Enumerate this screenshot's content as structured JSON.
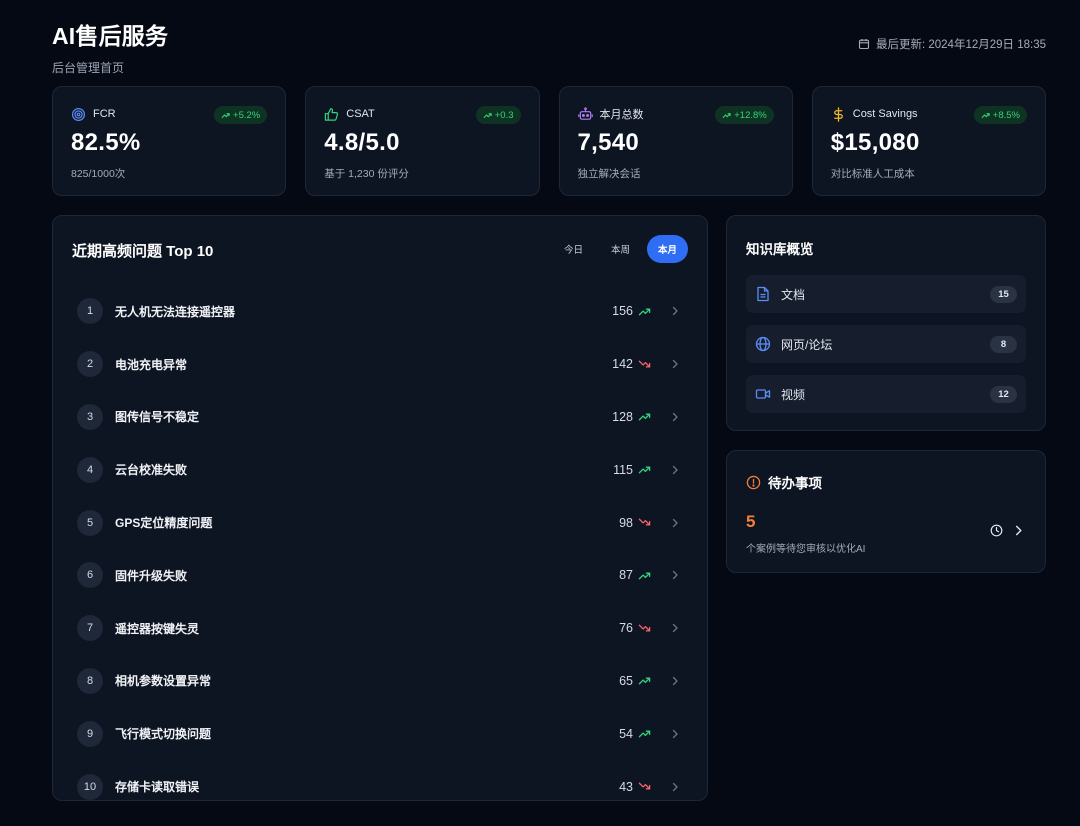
{
  "header": {
    "title": "AI售后服务",
    "subtitle": "后台管理首页",
    "last_update": "最后更新: 2024年12月29日 18:35"
  },
  "kpis": [
    {
      "label": "FCR",
      "icon": "target-icon",
      "value": "82.5%",
      "delta": "+5.2%",
      "sub": "825/1000次"
    },
    {
      "label": "CSAT",
      "icon": "thumbs-up-icon",
      "value": "4.8/5.0",
      "delta": "+0.3",
      "sub": "基于 1,230 份评分"
    },
    {
      "label": "本月总数",
      "icon": "robot-icon",
      "value": "7,540",
      "delta": "+12.8%",
      "sub": "独立解决会话"
    },
    {
      "label": "Cost Savings",
      "icon": "dollar-icon",
      "value": "$15,080",
      "delta": "+8.5%",
      "sub": "对比标准人工成本"
    }
  ],
  "issues_panel": {
    "title": "近期高频问题 Top 10",
    "tabs": [
      {
        "label": "今日",
        "active": false
      },
      {
        "label": "本周",
        "active": false
      },
      {
        "label": "本月",
        "active": true
      }
    ],
    "rows": [
      {
        "rank": "1",
        "name": "无人机无法连接遥控器",
        "count": "156",
        "trend": "up"
      },
      {
        "rank": "2",
        "name": "电池充电异常",
        "count": "142",
        "trend": "down"
      },
      {
        "rank": "3",
        "name": "图传信号不稳定",
        "count": "128",
        "trend": "up"
      },
      {
        "rank": "4",
        "name": "云台校准失败",
        "count": "115",
        "trend": "up"
      },
      {
        "rank": "5",
        "name": "GPS定位精度问题",
        "count": "98",
        "trend": "down"
      },
      {
        "rank": "6",
        "name": "固件升级失败",
        "count": "87",
        "trend": "up"
      },
      {
        "rank": "7",
        "name": "遥控器按键失灵",
        "count": "76",
        "trend": "down"
      },
      {
        "rank": "8",
        "name": "相机参数设置异常",
        "count": "65",
        "trend": "up"
      },
      {
        "rank": "9",
        "name": "飞行模式切换问题",
        "count": "54",
        "trend": "up"
      },
      {
        "rank": "10",
        "name": "存储卡读取错误",
        "count": "43",
        "trend": "down"
      }
    ]
  },
  "knowledge_base": {
    "title": "知识库概览",
    "items": [
      {
        "label": "文档",
        "icon": "document-icon",
        "count": "15"
      },
      {
        "label": "网页/论坛",
        "icon": "globe-icon",
        "count": "8"
      },
      {
        "label": "视频",
        "icon": "video-icon",
        "count": "12"
      }
    ]
  },
  "todo": {
    "title": "待办事项",
    "count": "5",
    "description": "个案例等待您审核以优化AI"
  },
  "colors": {
    "background": "#050914",
    "card": "#0d1422",
    "accent_blue": "#2f6df5",
    "trend_up": "#34d27b",
    "trend_down": "#f0646b",
    "warning_orange": "#f47f3a"
  }
}
